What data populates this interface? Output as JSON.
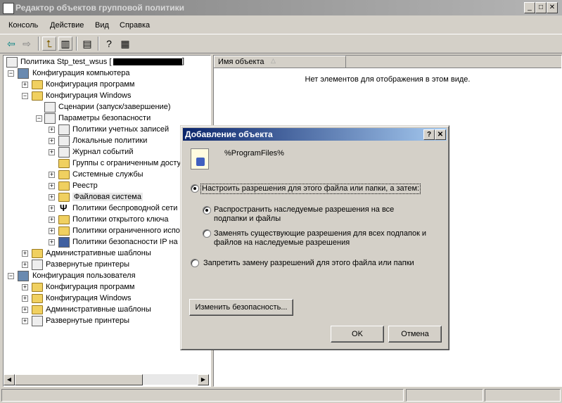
{
  "window": {
    "title": "Редактор объектов групповой политики"
  },
  "menu": [
    "Консоль",
    "Действие",
    "Вид",
    "Справка"
  ],
  "toolbar": {
    "icons": [
      "back-icon",
      "forward-icon",
      "up-folder-icon",
      "show-tree-icon",
      "export-list-icon",
      "help-icon",
      "properties-icon"
    ]
  },
  "tree": {
    "root": "Политика Stp_test_wsus [",
    "computer_config": "Конфигурация компьютера",
    "cc_programs": "Конфигурация программ",
    "cc_windows": "Конфигурация Windows",
    "scripts": "Сценарии (запуск/завершение)",
    "security": "Параметры безопасности",
    "account_policies": "Политики учетных записей",
    "local_policies": "Локальные политики",
    "event_log": "Журнал событий",
    "restricted_groups": "Группы с ограниченным досту",
    "system_services": "Системные службы",
    "registry": "Реестр",
    "file_system": "Файловая система",
    "wireless": "Политики беспроводной сети",
    "public_key": "Политики открытого ключа",
    "software_restriction": "Политики ограниченного испо",
    "ip_security": "Политики безопасности IP на",
    "admin_templates": "Административные шаблоны",
    "printers": "Развернутые принтеры",
    "user_config": "Конфигурация пользователя",
    "uc_programs": "Конфигурация программ",
    "uc_windows": "Конфигурация Windows",
    "uc_admin_templates": "Административные шаблоны",
    "uc_printers": "Развернутые принтеры"
  },
  "list": {
    "column_name": "Имя объекта",
    "empty_text": "Нет элементов для отображения в этом виде."
  },
  "dialog": {
    "title": "Добавление объекта",
    "object_path": "%ProgramFiles%",
    "opt_configure": "Настроить разрешения для этого файла или папки, а затем:",
    "opt_propagate_l1": "Распространить наследуемые разрешения на все",
    "opt_propagate_l2": "подпапки и файлы",
    "opt_replace_l1": "Заменять существующие разрешения для всех подпапок и",
    "opt_replace_l2": "файлов на наследуемые разрешения",
    "opt_deny": "Запретить замену разрешений для этого файла или папки",
    "edit_security": "Изменить безопасность...",
    "ok": "OK",
    "cancel": "Отмена",
    "selected_main": "configure",
    "selected_sub": "propagate"
  }
}
